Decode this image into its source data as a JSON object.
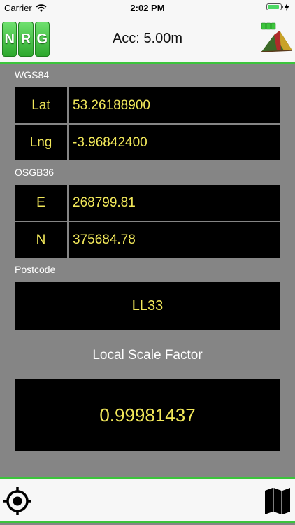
{
  "status_bar": {
    "carrier": "Carrier",
    "time": "2:02 PM"
  },
  "header": {
    "logo_letters": [
      "N",
      "R",
      "G"
    ],
    "accuracy_title": "Acc: 5.00m"
  },
  "wgs84": {
    "label": "WGS84",
    "lat_label": "Lat",
    "lat_value": "53.26188900",
    "lng_label": "Lng",
    "lng_value": "-3.96842400"
  },
  "osgb36": {
    "label": "OSGB36",
    "e_label": "E",
    "e_value": "268799.81",
    "n_label": "N",
    "n_value": "375684.78"
  },
  "postcode": {
    "label": "Postcode",
    "value": "LL33"
  },
  "local_scale_factor": {
    "label": "Local Scale Factor",
    "value": "0.99981437"
  },
  "colors": {
    "accent_green": "#3cc43c",
    "value_yellow": "#f2e85a",
    "background_gray": "#858585"
  },
  "icons": {
    "locate": "crosshair-target-icon",
    "map": "folded-map-icon"
  }
}
